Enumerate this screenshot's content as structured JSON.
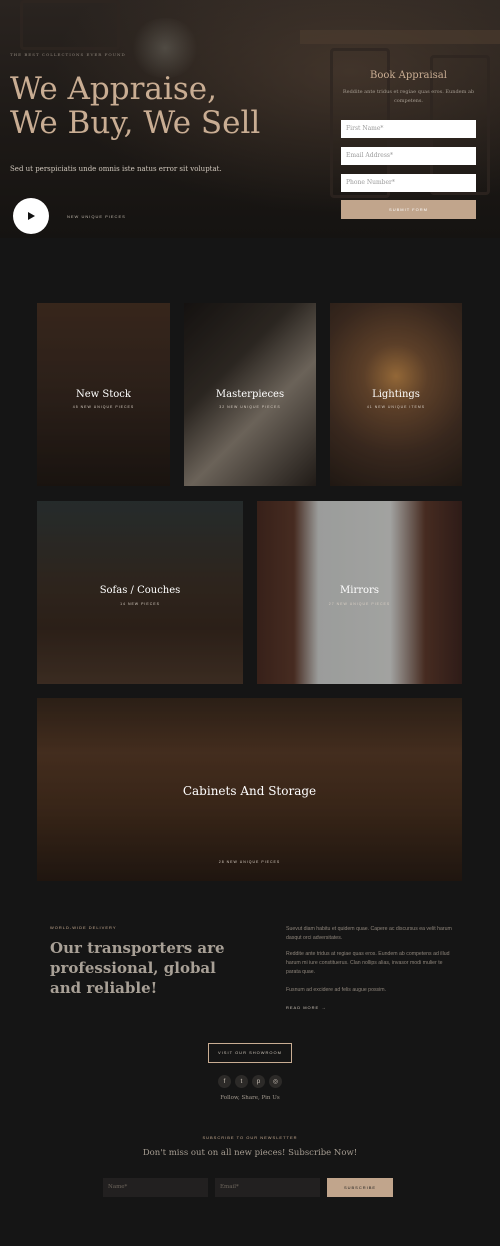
{
  "hero": {
    "kicker": "The best collections ever found",
    "title": "We Appraise, We Buy, We Sell",
    "subtitle": "Sed ut perspiciatis unde omnis iste natus error sit voluptat.",
    "play_label": "New Unique Pieces"
  },
  "appraisal_form": {
    "title": "Book Appraisal",
    "description": "Reddite ante tridus et regiae quas eros. Eundem ab competens.",
    "first_name_placeholder": "First Name*",
    "email_placeholder": "Email Address*",
    "phone_placeholder": "Phone Number*",
    "submit_label": "Submit Form"
  },
  "categories": [
    {
      "label": "New Stock",
      "sub": "45 New Unique Pieces"
    },
    {
      "label": "Masterpieces",
      "sub": "32 New Unique Pieces"
    },
    {
      "label": "Lightings",
      "sub": "41 New Unique Items"
    },
    {
      "label": "Sofas / Couches",
      "sub": "14 New Pieces"
    },
    {
      "label": "Mirrors",
      "sub": "27 New Unique Pieces"
    },
    {
      "label": "Cabinets And Storage",
      "sub": "28 New Unique Pieces"
    }
  ],
  "delivery": {
    "kicker": "World-Wide Delivery",
    "title": "Our transporters are professional, global and reliable!",
    "paragraphs": [
      "Suevut diam habitu et quidem quae. Capere ac discursus ea velit harum dasqut orci adversitates.",
      "Reddite ante tridus at regiae quas eros. Eundem ab competens ad illud harum mi iure constituerus. Clan nollips alias, invasor modi mulier te parata quae.",
      "Fusnum ad excidere ad felis augue possim."
    ],
    "read_more": "Read More →"
  },
  "showroom": {
    "button_label": "Visit Our Showroom",
    "social_icons": [
      "f",
      "t",
      "p",
      "◎"
    ],
    "follow_text": "Follow, Share, Pin Us"
  },
  "newsletter": {
    "kicker": "Subscribe to our newsletter",
    "title": "Don't miss out on all new pieces! Subscribe Now!",
    "name_placeholder": "Name*",
    "email_placeholder": "Email*",
    "subscribe_label": "Subscribe"
  },
  "colors": {
    "accent": "#c1a58c",
    "title": "#c9ad93",
    "background": "#151515"
  }
}
